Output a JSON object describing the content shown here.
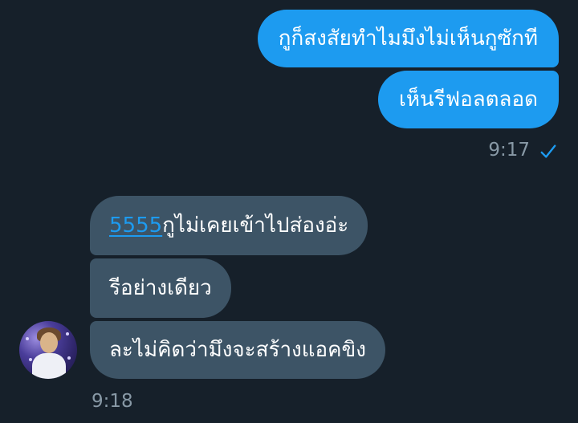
{
  "sent_messages": [
    {
      "text": "กูก็สงสัยทำไมมึงไม่เห็นกูซักที"
    },
    {
      "text": "เห็นรีฟอลตลอด"
    }
  ],
  "sent_time": "9:17",
  "sent_status_icon": "checkmark-icon",
  "received_messages": [
    {
      "link": "5555",
      "text": "กูไม่เคยเข้าไปส่องอ่ะ"
    },
    {
      "text": "รีอย่างเดียว"
    },
    {
      "text": "ละไม่คิดว่ามึงจะสร้างแอคขิง"
    }
  ],
  "received_time": "9:18",
  "colors": {
    "background": "#16202a",
    "sent_bubble": "#1d9bf0",
    "received_bubble": "#3d5466",
    "timestamp": "#8899a6",
    "link": "#1d9bf0"
  }
}
